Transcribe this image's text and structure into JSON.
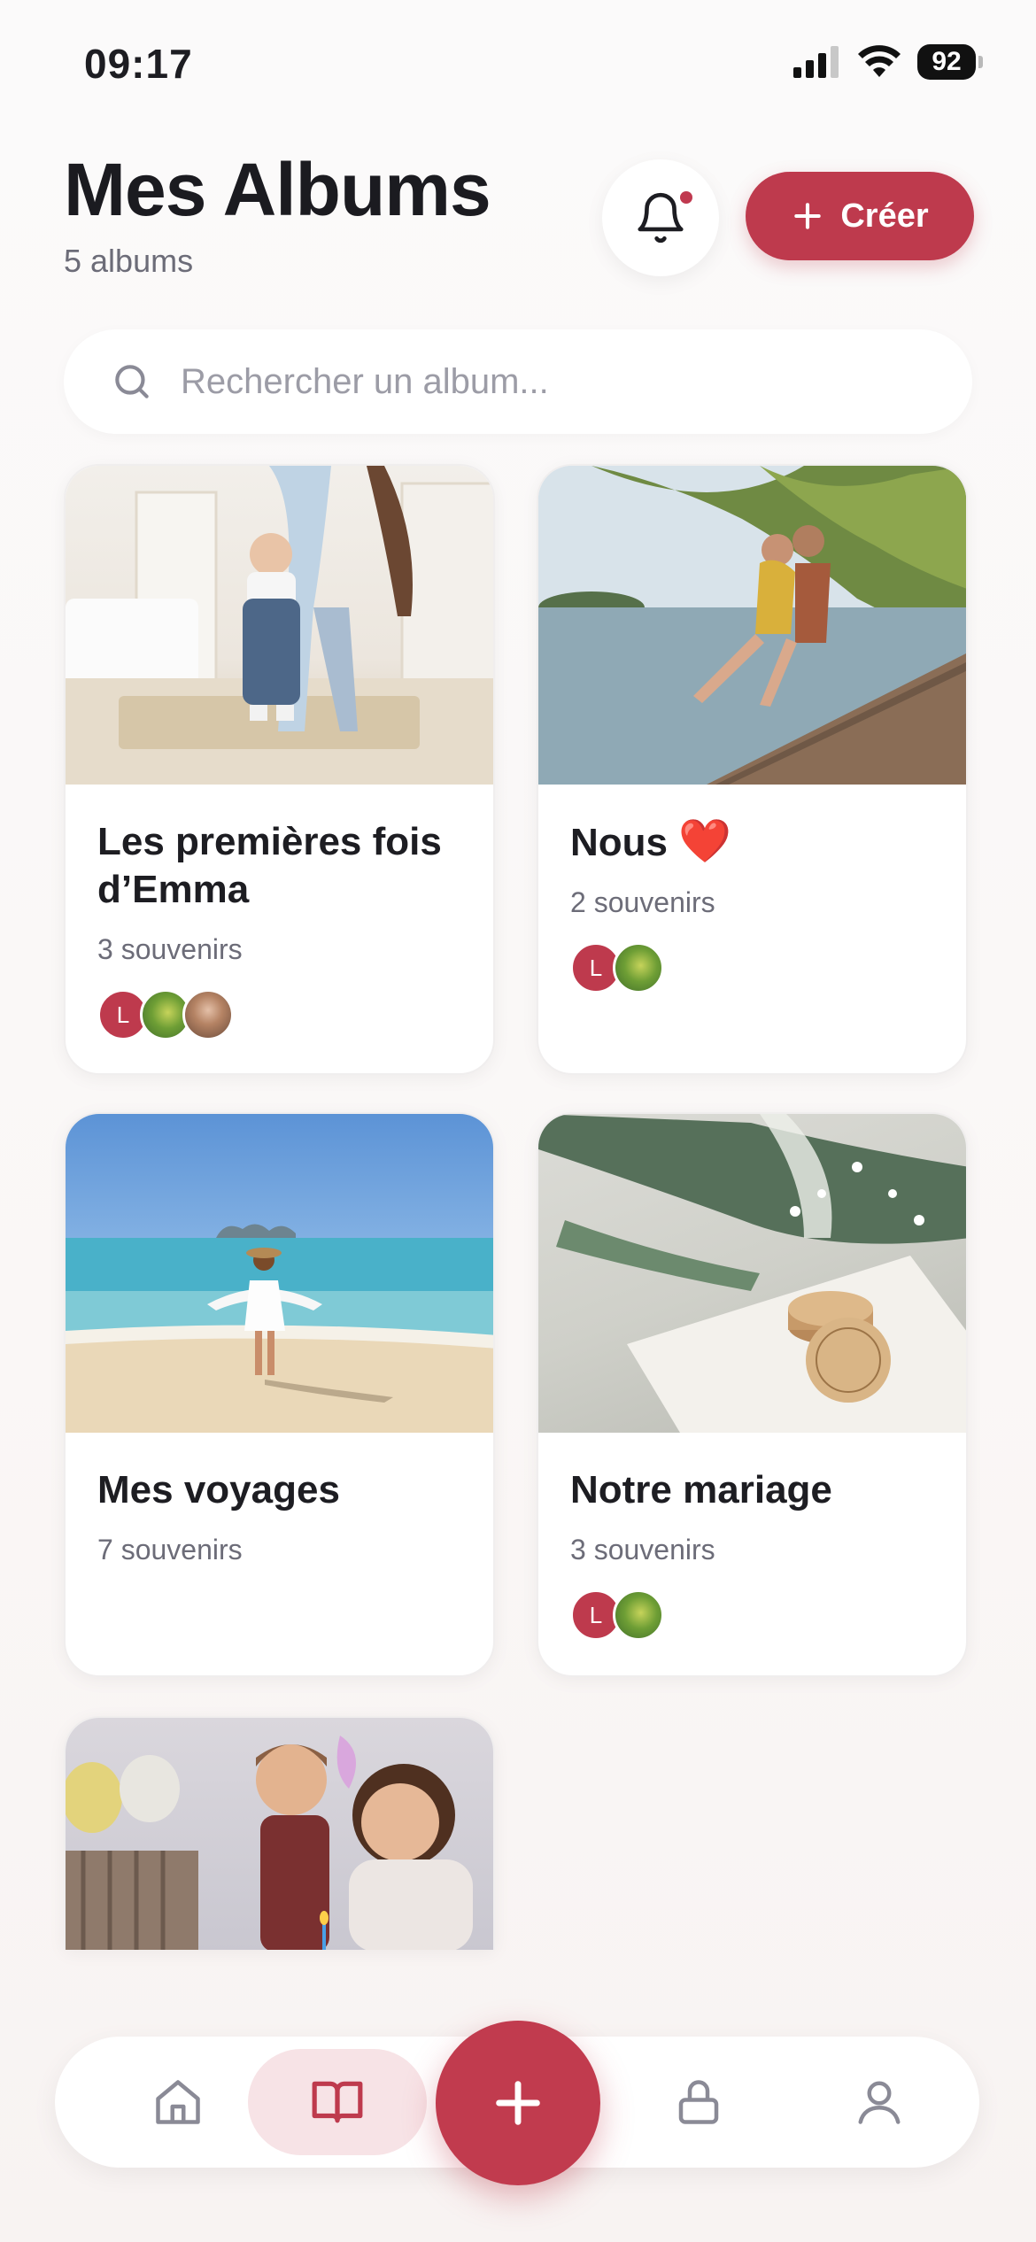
{
  "status_bar": {
    "time": "09:17",
    "battery": "92"
  },
  "header": {
    "title": "Mes Albums",
    "subtitle": "5 albums",
    "create_label": "Créer"
  },
  "search": {
    "placeholder": "Rechercher un album..."
  },
  "albums": [
    {
      "title": "Les premières fois d’Emma",
      "count": "3 souvenirs",
      "avatar_letter": "L"
    },
    {
      "title": "Nous",
      "emoji": "❤️",
      "count": "2 souvenirs",
      "avatar_letter": "L"
    },
    {
      "title": "Mes voyages",
      "count": "7 souvenirs"
    },
    {
      "title": "Notre mariage",
      "count": "3 souvenirs",
      "avatar_letter": "L"
    },
    {
      "title": ""
    }
  ],
  "nav": {
    "items": [
      "home-icon",
      "book-icon",
      "plus-icon",
      "lock-icon",
      "user-icon"
    ],
    "active": "book-icon"
  },
  "colors": {
    "accent": "#be3a4d",
    "accent_soft": "#f7e3e6",
    "text_secondary": "#6c6c78"
  }
}
